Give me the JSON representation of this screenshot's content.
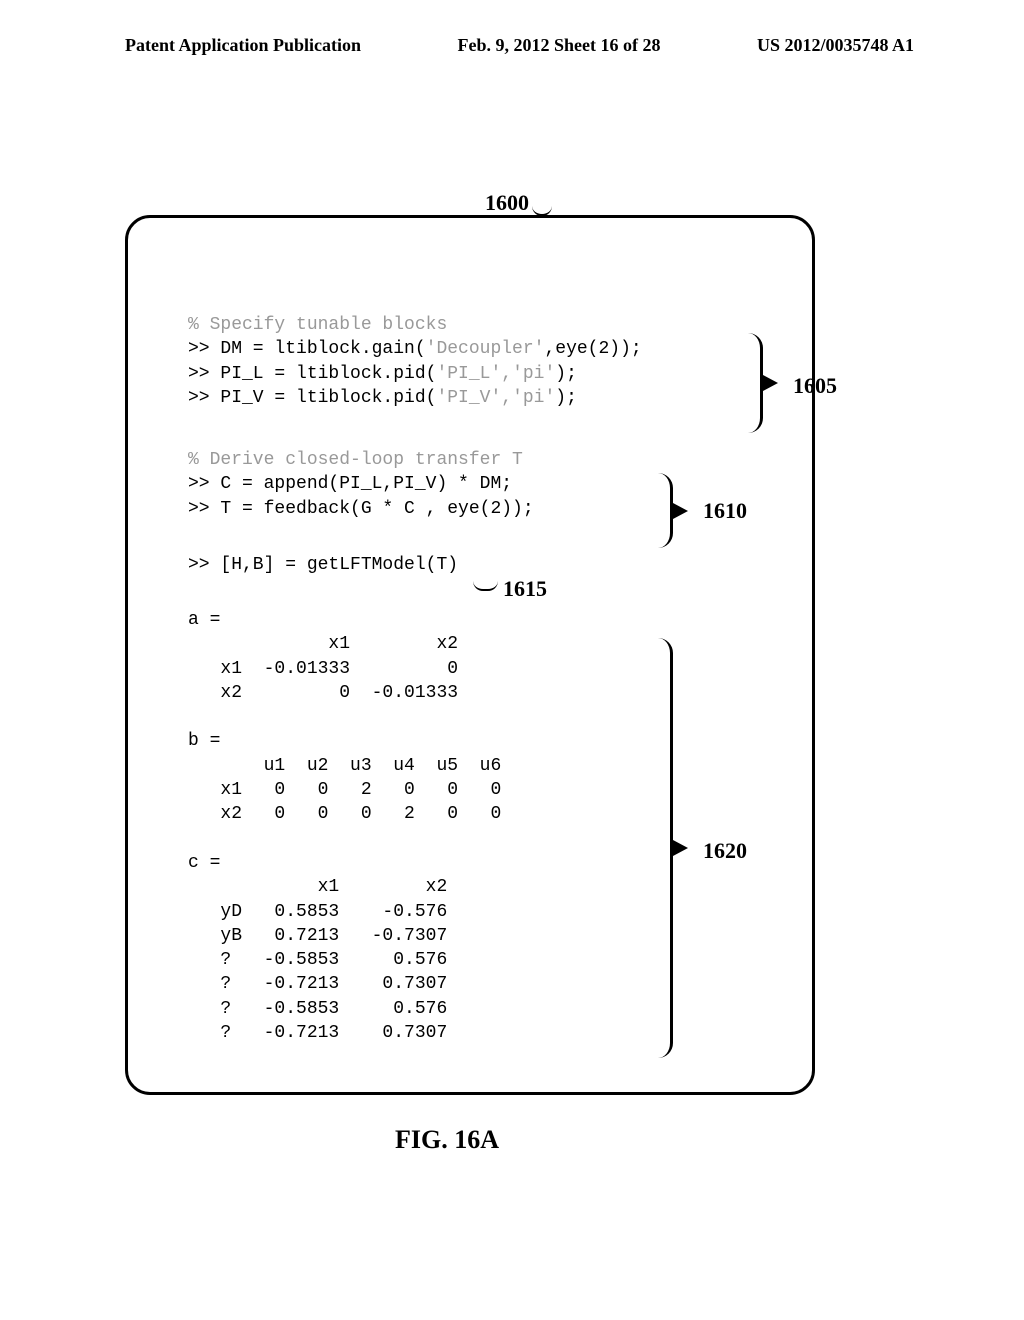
{
  "header": {
    "left": "Patent Application Publication",
    "center": "Feb. 9, 2012  Sheet 16 of 28",
    "right": "US 2012/0035748 A1"
  },
  "figure_ref": "1600",
  "callouts": {
    "c1605": "1605",
    "c1610": "1610",
    "c1615": "1615",
    "c1620": "1620"
  },
  "code": {
    "comment1": "% Specify tunable blocks",
    "line_dm_pre": ">> DM = ltiblock.gain(",
    "line_dm_arg": "'Decoupler'",
    "line_dm_post": ",eye(2));",
    "line_pil_pre": ">> PI_L = ltiblock.pid(",
    "line_pil_arg": "'PI_L','pi'",
    "line_pil_post": ");",
    "line_piv_pre": ">> PI_V = ltiblock.pid(",
    "line_piv_arg": "'PI_V','pi'",
    "line_piv_post": ");",
    "comment2": "% Derive closed-loop transfer T",
    "line_c": ">> C = append(PI_L,PI_V) * DM;",
    "line_t": ">> T = feedback(G * C , eye(2));",
    "line_hb": ">> [H,B] = getLFTModel(T)",
    "matrix_output": "a =\n             x1        x2\n   x1  -0.01333         0\n   x2         0  -0.01333\n\nb =\n       u1  u2  u3  u4  u5  u6\n   x1   0   0   2   0   0   0\n   x2   0   0   0   2   0   0\n\nc =\n            x1        x2\n   yD   0.5853    -0.576\n   yB   0.7213   -0.7307\n   ?   -0.5853     0.576\n   ?   -0.7213    0.7307\n   ?   -0.5853     0.576\n   ?   -0.7213    0.7307"
  },
  "caption": "FIG. 16A"
}
